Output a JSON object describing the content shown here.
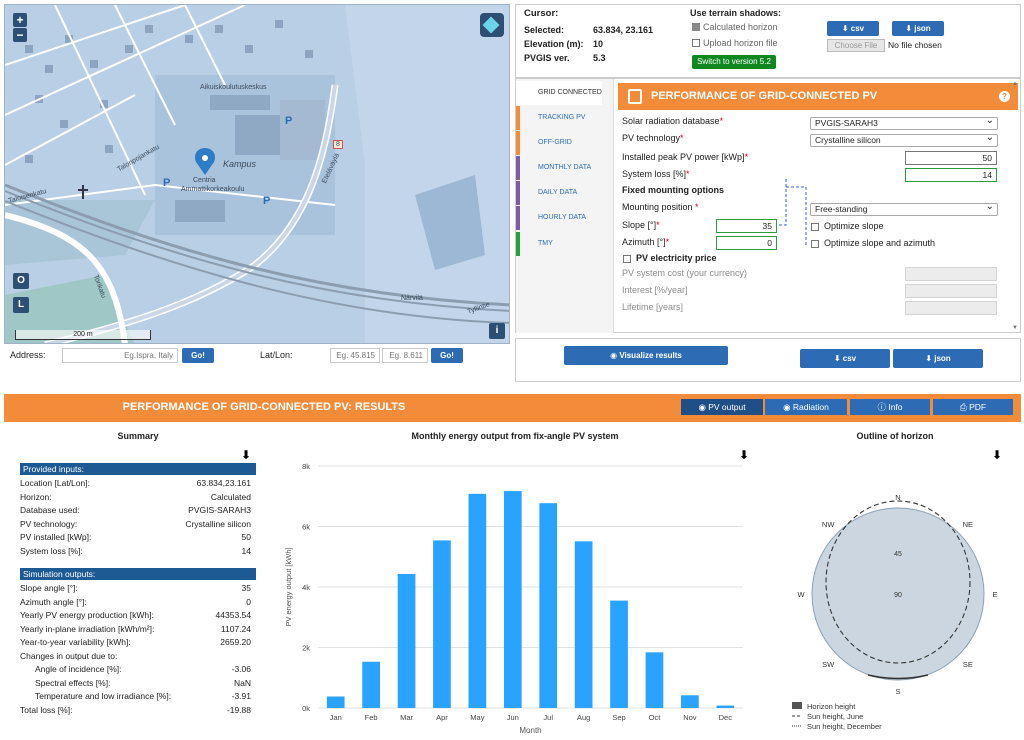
{
  "map": {
    "zoom_in": "+",
    "zoom_out": "−",
    "btn_o": "O",
    "btn_l": "L",
    "btn_i": "i",
    "scale_label": "200 m",
    "labels": [
      {
        "text": "Kampus",
        "name": "kampus"
      },
      {
        "text": "Centria",
        "name": "centria"
      },
      {
        "text": "Ammattikorkeakoulu",
        "name": "ammattikorkeakoulu"
      },
      {
        "text": "Aikuiskoulutuskeskus",
        "name": "aikuiskoulutuskeskus"
      },
      {
        "text": "Närvilä",
        "name": "narvila"
      },
      {
        "text": "Eteläväylä",
        "name": "etelavayla"
      },
      {
        "text": "Talonpojankatu",
        "name": "talonpojankatu"
      },
      {
        "text": "Taloisenkatu",
        "name": "taloisenkatu"
      },
      {
        "text": "Torikatu",
        "name": "torikatu"
      },
      {
        "text": "Tyllintie",
        "name": "tyllintie"
      },
      {
        "text": "8",
        "name": "road-8"
      },
      {
        "text": "P",
        "name": "parking-1"
      },
      {
        "text": "P",
        "name": "parking-2"
      },
      {
        "text": "P",
        "name": "parking-3"
      }
    ]
  },
  "address": {
    "label": "Address:",
    "placeholder": "Eg.Ispra, Italy",
    "go": "Go!",
    "latlon_label": "Lat/Lon:",
    "lat_placeholder": "Eg. 45.815",
    "lon_placeholder": "Eg. 8.611",
    "go2": "Go!"
  },
  "cursor_panel": {
    "cursor_label": "Cursor:",
    "selected_label": "Selected:",
    "selected_value": "63.834, 23.161",
    "elevation_label": "Elevation (m):",
    "elevation_value": "10",
    "pvgis_label": "PVGIS ver.",
    "pvgis_value": "5.3",
    "terrain_label": "Use terrain shadows:",
    "calc_horizon": "Calculated horizon",
    "upload_horizon": "Upload horizon file",
    "switch_btn": "Switch to version 5.2",
    "csv_btn": "csv",
    "json_btn": "json",
    "choose_file": "Choose File",
    "no_file": "No file chosen"
  },
  "tabs": [
    {
      "label": "GRID CONNECTED",
      "color": "#ffffff"
    },
    {
      "label": "TRACKING PV",
      "color": "#f28c3b"
    },
    {
      "label": "OFF-GRID",
      "color": "#f28c3b"
    },
    {
      "label": "MONTHLY DATA",
      "color": "#7a5ea8"
    },
    {
      "label": "DAILY DATA",
      "color": "#7a5ea8"
    },
    {
      "label": "HOURLY DATA",
      "color": "#7a5ea8"
    },
    {
      "label": "TMY",
      "color": "#2a9d3c"
    }
  ],
  "form": {
    "title": "PERFORMANCE OF GRID-CONNECTED PV",
    "help": "?",
    "solar_db_label": "Solar radiation database",
    "solar_db_value": "PVGIS-SARAH3",
    "pv_tech_label": "PV technology",
    "pv_tech_value": "Crystalline silicon",
    "peak_label": "Installed peak PV power [kWp]",
    "peak_value": "50",
    "loss_label": "System loss [%]",
    "loss_value": "14",
    "fixed_label": "Fixed mounting options",
    "mounting_label": "Mounting position",
    "mounting_value": "Free-standing",
    "slope_label": "Slope [°]",
    "slope_value": "35",
    "azimuth_label": "Azimuth [°]",
    "azimuth_value": "0",
    "opt_slope": "Optimize slope",
    "opt_slope_az": "Optimize slope and azimuth",
    "price_label": "PV electricity price",
    "cost_label": "PV system cost (your currency)",
    "interest_label": "Interest [%/year]",
    "lifetime_label": "Lifetime [years]"
  },
  "buttons": {
    "visualize": "Visualize results",
    "csv": "csv",
    "json": "json"
  },
  "results": {
    "title": "PERFORMANCE OF GRID-CONNECTED PV: RESULTS",
    "tabs": [
      "PV output",
      "Radiation",
      "Info",
      "PDF"
    ]
  },
  "summary": {
    "title": "Summary",
    "inputs_header": "Provided inputs:",
    "inputs": [
      {
        "label": "Location [Lat/Lon]:",
        "value": "63.834,23.161"
      },
      {
        "label": "Horizon:",
        "value": "Calculated"
      },
      {
        "label": "Database used:",
        "value": "PVGIS-SARAH3"
      },
      {
        "label": "PV technology:",
        "value": "Crystalline silicon"
      },
      {
        "label": "PV installed [kWp]:",
        "value": "50"
      },
      {
        "label": "System loss [%]:",
        "value": "14"
      }
    ],
    "outputs_header": "Simulation outputs:",
    "outputs": [
      {
        "label": "Slope angle [°]:",
        "value": "35",
        "indent": false
      },
      {
        "label": "Azimuth angle [°]:",
        "value": "0",
        "indent": false
      },
      {
        "label": "Yearly PV energy production [kWh]:",
        "value": "44353.54",
        "indent": false
      },
      {
        "label": "Yearly in-plane irradiation [kWh/m²]:",
        "value": "1107.24",
        "indent": false
      },
      {
        "label": "Year-to-year variability [kWh]:",
        "value": "2659.20",
        "indent": false
      },
      {
        "label": "Changes in output due to:",
        "value": "",
        "indent": false
      },
      {
        "label": "Angle of incidence [%]:",
        "value": "-3.06",
        "indent": true
      },
      {
        "label": "Spectral effects [%]:",
        "value": "NaN",
        "indent": true
      },
      {
        "label": "Temperature and low irradiance [%]:",
        "value": "-3.91",
        "indent": true
      },
      {
        "label": "Total loss [%]:",
        "value": "-19.88",
        "indent": false
      }
    ]
  },
  "chart_data": [
    {
      "type": "bar",
      "title": "Monthly energy output from fix-angle PV system",
      "xlabel": "Month",
      "ylabel": "PV energy output [kWh]",
      "categories": [
        "Jan",
        "Feb",
        "Mar",
        "Apr",
        "May",
        "Jun",
        "Jul",
        "Aug",
        "Sep",
        "Oct",
        "Nov",
        "Dec"
      ],
      "values": [
        380,
        1530,
        4430,
        5540,
        7080,
        7170,
        6770,
        5510,
        3550,
        1840,
        420,
        80
      ],
      "ylim": [
        0,
        8000
      ],
      "yticks": [
        "0k",
        "2k",
        "4k",
        "6k",
        "8k"
      ],
      "color": "#29a3ff",
      "grid": true
    },
    {
      "type": "polar",
      "title": "Outline of horizon",
      "directions": [
        "N",
        "NE",
        "E",
        "SE",
        "S",
        "SW",
        "W",
        "NW"
      ],
      "rings": [
        "45",
        "90"
      ],
      "legend": [
        "Horizon height",
        "Sun height, June",
        "Sun height, December"
      ],
      "legend_position": "bottom-left"
    }
  ],
  "colors": {
    "orange": "#f28c3b",
    "blue": "#2d6cb5",
    "navy": "#1d5a94",
    "green": "#11871f"
  }
}
